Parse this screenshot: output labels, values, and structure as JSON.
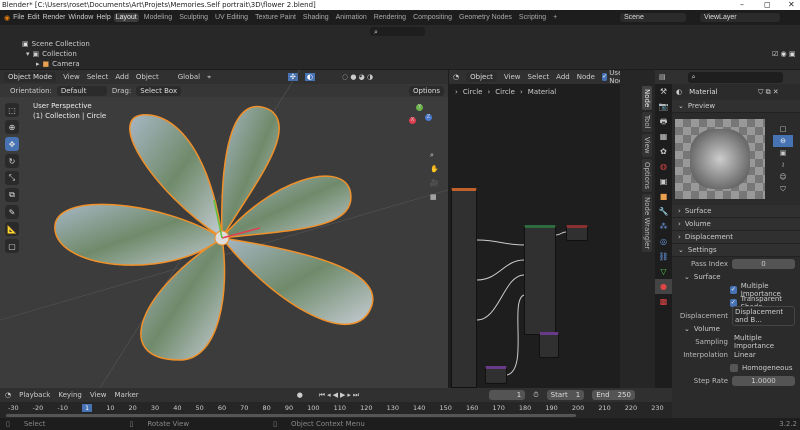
{
  "window": {
    "title": "Blender* [C:\\Users\\roset\\Documents\\Art\\Projets\\Memories.Self portrait\\3D\\flower 2.blend]",
    "minimize": "–",
    "maximize": "◻",
    "close": "✕"
  },
  "menu": {
    "items": [
      "File",
      "Edit",
      "Render",
      "Window",
      "Help"
    ],
    "workspaces": [
      "Layout",
      "Modeling",
      "Sculpting",
      "UV Editing",
      "Texture Paint",
      "Shading",
      "Animation",
      "Rendering",
      "Compositing",
      "Geometry Nodes",
      "Scripting",
      "+"
    ],
    "scene": "Scene",
    "view_layer": "ViewLayer"
  },
  "outliner": {
    "items": [
      "Scene Collection",
      "Collection",
      "Camera"
    ]
  },
  "viewport": {
    "mode": "Object Mode",
    "menus": [
      "View",
      "Select",
      "Add",
      "Object"
    ],
    "transform": "Global",
    "orientation_label": "Orientation:",
    "orientation": "Default",
    "drag_label": "Drag:",
    "drag": "Select Box",
    "options": "Options",
    "perspective": "User Perspective",
    "collection_info": "(1) Collection | Circle",
    "axes": [
      "Y",
      "X",
      "Z"
    ]
  },
  "node_editor": {
    "type": "Object",
    "menus": [
      "View",
      "Select",
      "Add",
      "Node"
    ],
    "use_nodes": "Use Nodes",
    "breadcrumb": [
      "Circle",
      "Circle",
      "Material"
    ],
    "sidebar_tabs": [
      "Node",
      "Tool",
      "View",
      "Options",
      "Node Wrangler"
    ]
  },
  "properties": {
    "material": "Material",
    "sections": {
      "preview": "Preview",
      "surface": "Surface",
      "volume": "Volume",
      "displacement": "Displacement",
      "settings": "Settings"
    },
    "pass_index_label": "Pass Index",
    "pass_index": "0",
    "surface_sub": "Surface",
    "multiple_importance": "Multiple Importance",
    "transparent_shadows": "Transparent Shado...",
    "displacement_label": "Displacement",
    "displacement": "Displacement and B...",
    "volume_sub": "Volume",
    "sampling_label": "Sampling",
    "sampling": "Multiple Importance",
    "interpolation_label": "Interpolation",
    "interpolation": "Linear",
    "homogeneous": "Homogeneous",
    "step_rate_label": "Step Rate",
    "step_rate": "1.0000"
  },
  "timeline": {
    "menus": [
      "Playback",
      "Keying",
      "View",
      "Marker"
    ],
    "current_frame": "1",
    "start_label": "Start",
    "start": "1",
    "end_label": "End",
    "end": "250",
    "ticks": [
      "-30",
      "-20",
      "-10",
      "1",
      "10",
      "20",
      "30",
      "40",
      "50",
      "60",
      "70",
      "80",
      "90",
      "100",
      "110",
      "120",
      "130",
      "140",
      "150",
      "160",
      "170",
      "180",
      "190",
      "200",
      "210",
      "220",
      "230"
    ]
  },
  "status": {
    "items": [
      "Select",
      "Rotate View",
      "Object Context Menu"
    ],
    "version": "3.2.2"
  },
  "colors": {
    "accent": "#4772b3",
    "outline": "#f0902a"
  }
}
